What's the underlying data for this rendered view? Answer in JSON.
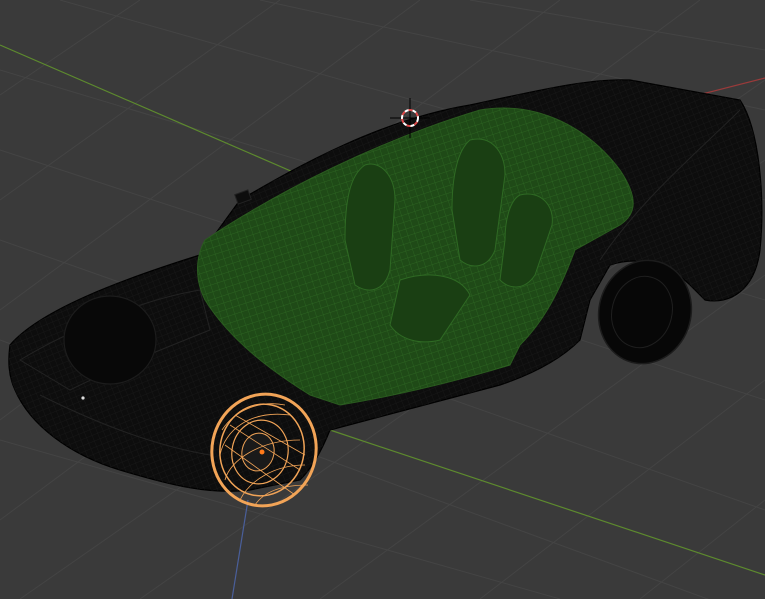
{
  "viewport": {
    "background_color": "#3a3a3a",
    "grid_color": "#444444",
    "x_axis_color": "#9a3a3a",
    "y_axis_color": "#5d8a2e",
    "z_axis_color": "#4a5f9a",
    "mode": "wireframe"
  },
  "scene": {
    "objects": [
      {
        "name": "car-body",
        "wire_color": "#000000"
      },
      {
        "name": "car-interior",
        "wire_color": "#1f4a17"
      },
      {
        "name": "front-wheel-selected",
        "wire_color": "#f2a457",
        "selected": true
      },
      {
        "name": "rear-wheel",
        "wire_color": "#000000"
      }
    ],
    "cursor": {
      "color_primary": "#e04a4a",
      "color_secondary": "#ffffff",
      "cross_color": "#000000"
    }
  }
}
